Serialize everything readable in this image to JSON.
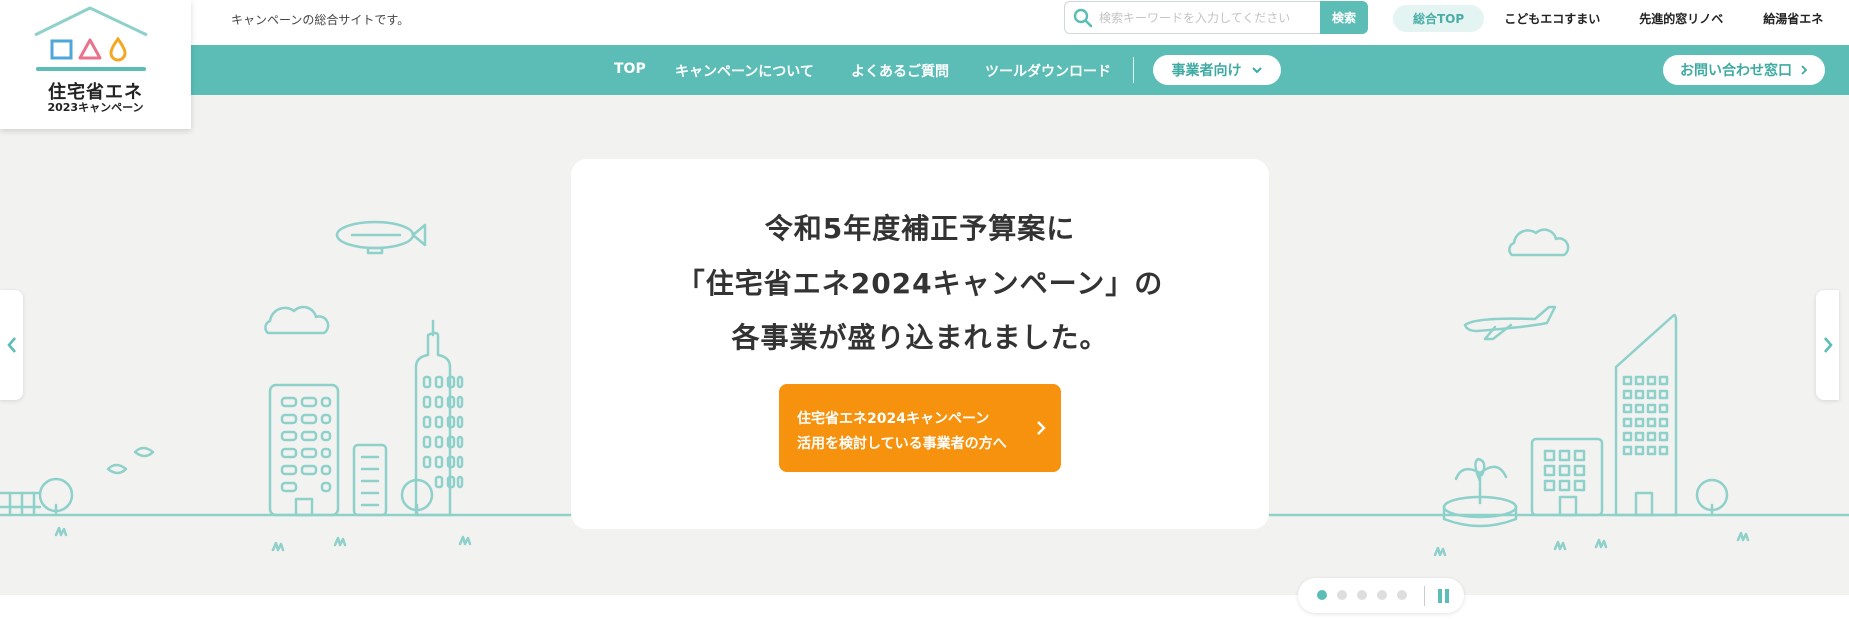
{
  "topbar": {
    "tagline": "キャンペーンの総合サイトです。",
    "search_placeholder": "検索キーワードを入力してください",
    "search_button": "検索",
    "site_links": [
      "総合TOP",
      "こどもエコすまい",
      "先進的窓リノベ",
      "給湯省エネ"
    ]
  },
  "logo": {
    "name": "住宅省エネ",
    "sub": "2023キャンペーン"
  },
  "nav": {
    "items": [
      "TOP",
      "キャンペーンについて",
      "よくあるご質問",
      "ツールダウンロード"
    ],
    "business_dropdown": "事業者向け",
    "contact": "お問い合わせ窓口"
  },
  "hero": {
    "lines": [
      "令和5年度補正予算案に",
      "「住宅省エネ2024キャンペーン」の",
      "各事業が盛り込まれました。"
    ],
    "cta_line1": "住宅省エネ2024キャンペーン",
    "cta_line2": "活用を検討している事業者の方へ"
  },
  "slider": {
    "slide_count": 5,
    "current_slide": 1
  },
  "colors": {
    "brand_teal": "#5bbdb6",
    "cta_orange": "#f7920f",
    "illustration": "#8ed0ca",
    "hero_bg": "#f2f2f1"
  },
  "icons": {
    "search": "search-icon",
    "chevron_down": "chevron-down-icon",
    "chevron_right": "chevron-right-icon",
    "chevron_left": "chevron-left-icon",
    "pause": "pause-icon"
  }
}
